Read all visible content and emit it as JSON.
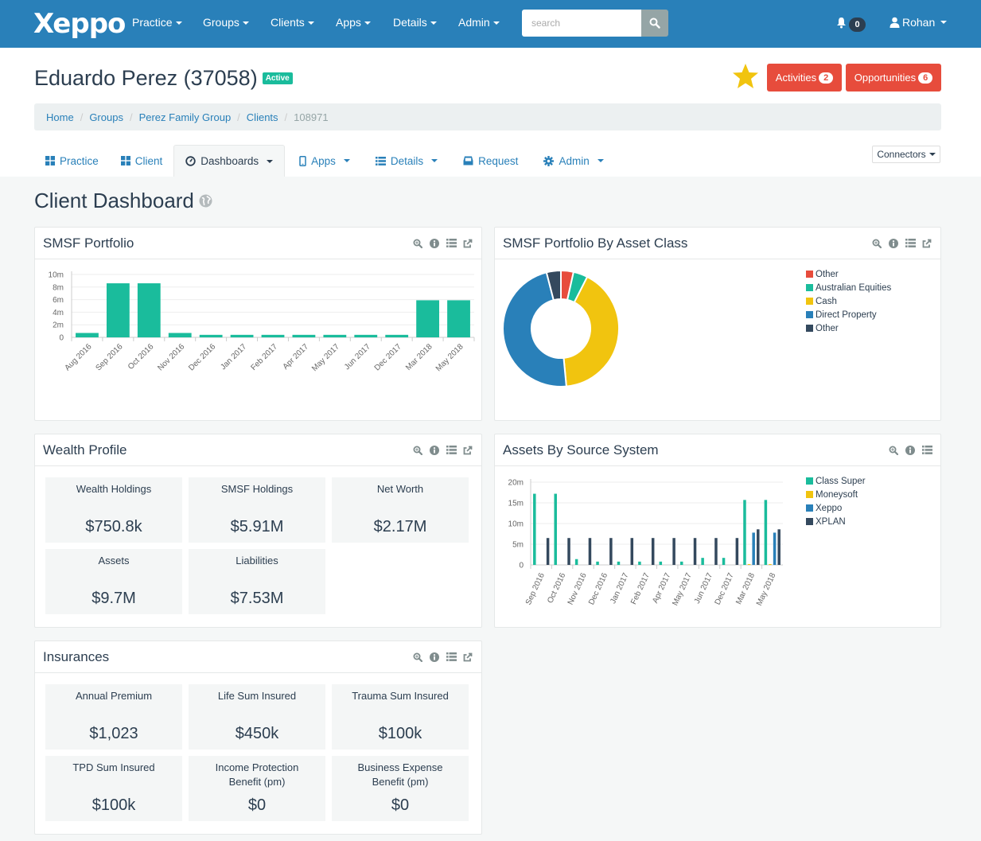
{
  "navbar": {
    "brand": "Xeppo",
    "items": [
      "Practice",
      "Groups",
      "Clients",
      "Apps",
      "Details",
      "Admin"
    ],
    "search_placeholder": "search",
    "notifications_count": "0",
    "user_name": "Rohan"
  },
  "header": {
    "client_name": "Eduardo Perez (37058)",
    "status": "Active",
    "activities_label": "Activities",
    "activities_count": "2",
    "opportunities_label": "Opportunities",
    "opportunities_count": "6"
  },
  "breadcrumb": {
    "items": [
      "Home",
      "Groups",
      "Perez Family Group",
      "Clients"
    ],
    "current": "108971"
  },
  "tabs": [
    {
      "label": "Practice",
      "icon": "grid-icon",
      "dropdown": false
    },
    {
      "label": "Client",
      "icon": "grid-icon",
      "dropdown": false
    },
    {
      "label": "Dashboards",
      "icon": "dashboard-icon",
      "dropdown": true,
      "active": true
    },
    {
      "label": "Apps",
      "icon": "mobile-icon",
      "dropdown": true
    },
    {
      "label": "Details",
      "icon": "list-icon",
      "dropdown": true
    },
    {
      "label": "Request",
      "icon": "inbox-icon",
      "dropdown": false
    },
    {
      "label": "Admin",
      "icon": "gear-icon",
      "dropdown": true
    }
  ],
  "connectors_label": "Connectors",
  "dashboard_title": "Client Dashboard",
  "colors": {
    "primary": "#2980b9",
    "teal": "#1abc9c",
    "red": "#e74c3c",
    "yellow": "#f1c40f",
    "dark": "#34495e"
  },
  "panels": {
    "smsf_portfolio": {
      "title": "SMSF Portfolio"
    },
    "asset_class": {
      "title": "SMSF Portfolio By Asset Class"
    },
    "wealth_profile": {
      "title": "Wealth Profile",
      "tiles": [
        {
          "label": "Wealth Holdings",
          "value": "$750.8k"
        },
        {
          "label": "SMSF Holdings",
          "value": "$5.91M"
        },
        {
          "label": "Net Worth",
          "value": "$2.17M"
        },
        {
          "label": "Assets",
          "value": "$9.7M"
        },
        {
          "label": "Liabilities",
          "value": "$7.53M"
        }
      ]
    },
    "source_system": {
      "title": "Assets By Source System"
    },
    "insurances": {
      "title": "Insurances",
      "tiles": [
        {
          "label": "Annual Premium",
          "value": "$1,023"
        },
        {
          "label": "Life Sum Insured",
          "value": "$450k"
        },
        {
          "label": "Trauma Sum Insured",
          "value": "$100k"
        },
        {
          "label": "TPD Sum Insured",
          "value": "$100k"
        },
        {
          "label": "Income Protection Benefit (pm)",
          "value": "$0"
        },
        {
          "label": "Business Expense Benefit (pm)",
          "value": "$0"
        }
      ]
    }
  },
  "chart_data": [
    {
      "type": "bar",
      "title": "SMSF Portfolio",
      "categories": [
        "Aug 2016",
        "Sep 2016",
        "Oct 2016",
        "Nov 2016",
        "Dec 2016",
        "Jan 2017",
        "Feb 2017",
        "Apr 2017",
        "May 2017",
        "Jun 2017",
        "Dec 2017",
        "Mar 2018",
        "May 2018"
      ],
      "values": [
        0.7,
        8.6,
        8.6,
        0.7,
        0.4,
        0.4,
        0.4,
        0.4,
        0.4,
        0.4,
        0.4,
        5.9,
        5.9
      ],
      "yticks": [
        "0",
        "2m",
        "4m",
        "6m",
        "8m",
        "10m"
      ],
      "ylim": [
        0,
        10
      ],
      "units": "millions",
      "color": "#1abc9c",
      "grid": true
    },
    {
      "type": "pie",
      "title": "SMSF Portfolio By Asset Class",
      "donut": true,
      "slices": [
        {
          "label": "Other",
          "value": 3.5,
          "color": "#e74c3c"
        },
        {
          "label": "Australian Equities",
          "value": 4.0,
          "color": "#1abc9c"
        },
        {
          "label": "Cash",
          "value": 41.0,
          "color": "#f1c40f"
        },
        {
          "label": "Direct Property",
          "value": 47.5,
          "color": "#2980b9"
        },
        {
          "label": "Other",
          "value": 4.0,
          "color": "#34495e"
        }
      ],
      "legend": "top-right"
    },
    {
      "type": "bar",
      "title": "Assets By Source System",
      "categories": [
        "Sep 2016",
        "Oct 2016",
        "Nov 2016",
        "Dec 2016",
        "Jan 2017",
        "Feb 2017",
        "Apr 2017",
        "May 2017",
        "Jun 2017",
        "Dec 2017",
        "Mar 2018",
        "May 2018"
      ],
      "series": [
        {
          "name": "Class Super",
          "color": "#1abc9c",
          "values": [
            17.2,
            17.2,
            1.4,
            0.8,
            0.8,
            0.8,
            0.8,
            0.8,
            1.7,
            1.7,
            15.7,
            15.7
          ]
        },
        {
          "name": "Moneysoft",
          "color": "#f1c40f",
          "values": [
            0,
            0,
            0,
            0,
            0,
            0,
            0,
            0,
            0,
            0,
            0.2,
            0.2
          ]
        },
        {
          "name": "Xeppo",
          "color": "#2980b9",
          "values": [
            0,
            0,
            0,
            0,
            0,
            0,
            0,
            0,
            0,
            0,
            7.8,
            7.8
          ]
        },
        {
          "name": "XPLAN",
          "color": "#34495e",
          "values": [
            6.5,
            6.5,
            6.5,
            6.5,
            6.5,
            6.5,
            6.5,
            6.5,
            6.5,
            6.5,
            8.6,
            8.6
          ]
        }
      ],
      "yticks": [
        "0",
        "5m",
        "10m",
        "15m",
        "20m"
      ],
      "ylim": [
        0,
        20
      ],
      "units": "millions",
      "legend": "top-right",
      "grid": true
    }
  ]
}
